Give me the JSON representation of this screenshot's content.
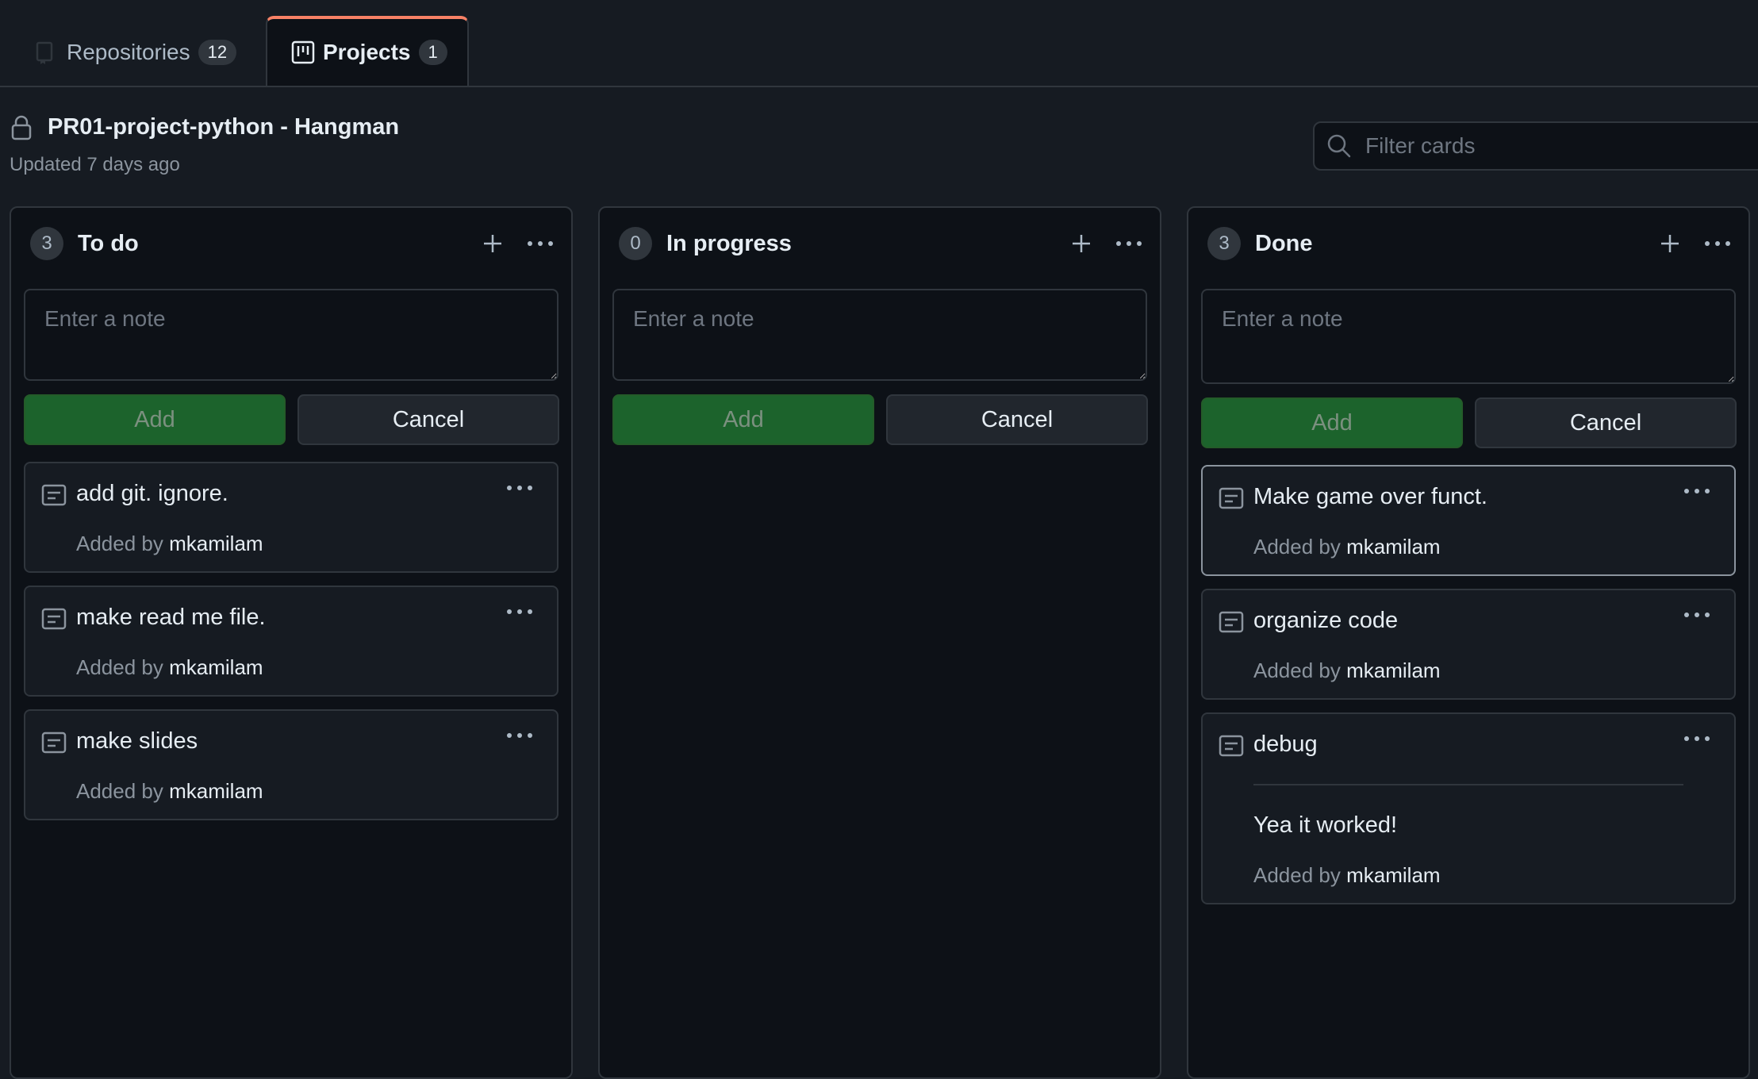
{
  "tabs": {
    "repositories": {
      "label": "Repositories",
      "count": "12"
    },
    "projects": {
      "label": "Projects",
      "count": "1"
    }
  },
  "project": {
    "title": "PR01-project-python - Hangman",
    "updated": "Updated 7 days ago"
  },
  "filter": {
    "placeholder": "Filter cards"
  },
  "colors": {
    "accent_tab": "#f78166",
    "add_button": "#238636",
    "background": "#0d1117"
  },
  "note_form": {
    "placeholder": "Enter a note",
    "add_label": "Add",
    "cancel_label": "Cancel"
  },
  "columns": [
    {
      "name": "To do",
      "count": "3",
      "cards": [
        {
          "title": "add git. ignore.",
          "added_by": "Added by",
          "author": "mkamilam"
        },
        {
          "title": "make read me file.",
          "added_by": "Added by",
          "author": "mkamilam"
        },
        {
          "title": "make slides",
          "added_by": "Added by",
          "author": "mkamilam"
        }
      ]
    },
    {
      "name": "In progress",
      "count": "0",
      "cards": []
    },
    {
      "name": "Done",
      "count": "3",
      "cards": [
        {
          "title": "Make game over funct.",
          "added_by": "Added by",
          "author": "mkamilam"
        },
        {
          "title": "organize code",
          "added_by": "Added by",
          "author": "mkamilam"
        },
        {
          "title": "debug",
          "body": "Yea it worked!",
          "added_by": "Added by",
          "author": "mkamilam"
        }
      ]
    }
  ],
  "icons": [
    "repo-icon",
    "project-icon",
    "lock-icon",
    "search-icon",
    "plus-icon",
    "kebab-icon",
    "note-icon"
  ]
}
